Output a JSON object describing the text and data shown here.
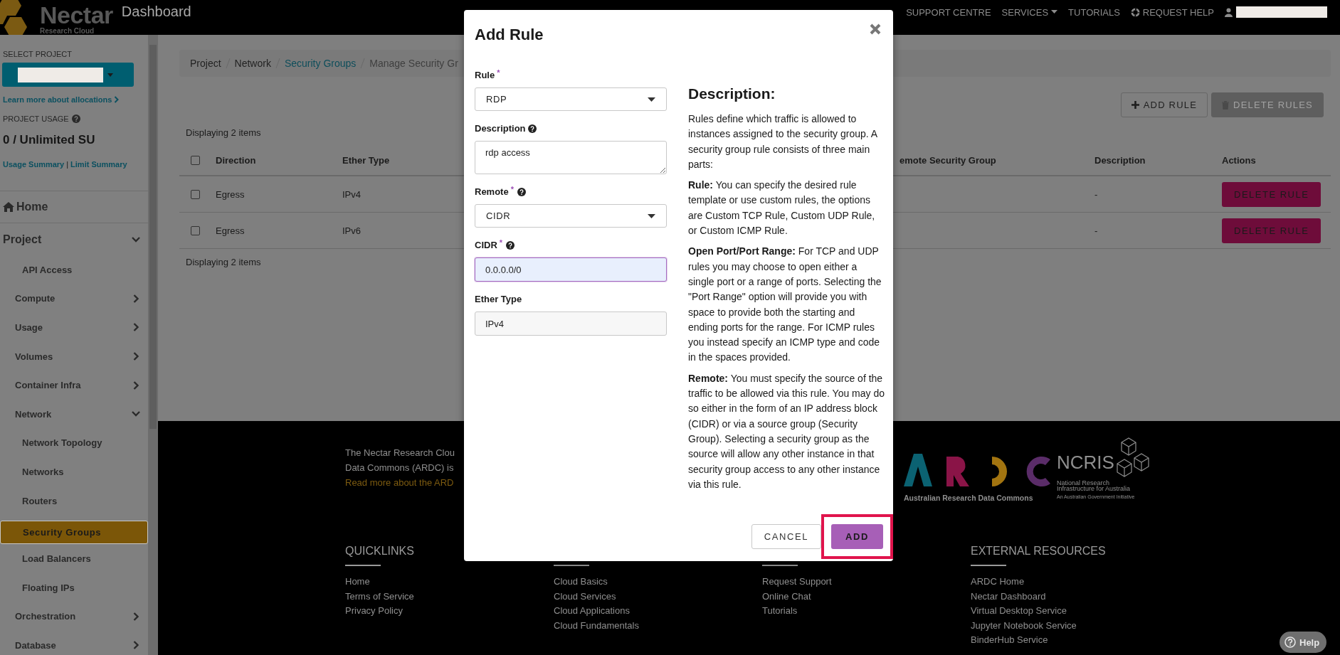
{
  "top_bar": {
    "brand": "Nectar",
    "brand_sub": "Research Cloud",
    "title": "Dashboard",
    "nav": [
      {
        "label": "SUPPORT CENTRE",
        "kind": "plain"
      },
      {
        "label": "SERVICES",
        "kind": "dropdown"
      },
      {
        "label": "TUTORIALS",
        "kind": "plain"
      },
      {
        "label": "REQUEST HELP",
        "kind": "help"
      }
    ]
  },
  "sidebar": {
    "select_project_label": "SELECT PROJECT",
    "allocations_link": "Learn more about allocations",
    "usage_label": "PROJECT USAGE",
    "usage_value": "0 / Unlimited SU",
    "usage_links": [
      "Usage Summary",
      "Limit Summary"
    ],
    "usage_separator": "|",
    "nav": [
      {
        "label": "Home",
        "kind": "home",
        "selected": false
      },
      {
        "label": "Project",
        "kind": "section",
        "selected": false,
        "expanded": true,
        "children": [
          {
            "label": "API Access",
            "selected": false
          },
          {
            "label": "Compute",
            "selected": false,
            "expanded": false
          },
          {
            "label": "Usage",
            "selected": false,
            "expanded": false
          },
          {
            "label": "Volumes",
            "selected": false,
            "expanded": false
          },
          {
            "label": "Container Infra",
            "selected": false,
            "expanded": false
          },
          {
            "label": "Network",
            "selected": false,
            "expanded": true,
            "children": [
              {
                "label": "Network Topology",
                "selected": false
              },
              {
                "label": "Networks",
                "selected": false
              },
              {
                "label": "Routers",
                "selected": false
              },
              {
                "label": "Security Groups",
                "selected": true
              },
              {
                "label": "Load Balancers",
                "selected": false
              },
              {
                "label": "Floating IPs",
                "selected": false
              }
            ]
          },
          {
            "label": "Orchestration",
            "selected": false,
            "expanded": false
          },
          {
            "label": "Database",
            "selected": false,
            "expanded": false
          }
        ]
      }
    ]
  },
  "main": {
    "breadcrumb": [
      {
        "label": "Project",
        "kind": "text"
      },
      {
        "label": "Network",
        "kind": "text"
      },
      {
        "label": "Security Groups",
        "kind": "link"
      },
      {
        "label": "Manage Security Gr",
        "kind": "current"
      }
    ],
    "actions": [
      {
        "label": "ADD RULE",
        "kind": "add",
        "disabled": false
      },
      {
        "label": "DELETE RULES",
        "kind": "delete",
        "disabled": true
      }
    ],
    "table": {
      "summary_top": "Displaying 2 items",
      "header_checked": false,
      "columns": [
        "Direction",
        "Ether Type",
        "emote Security Group",
        "Description",
        "Actions"
      ],
      "rows": [
        {
          "checked": false,
          "direction": "Egress",
          "ether_type": "IPv4",
          "description": "-",
          "action": "DELETE RULE"
        },
        {
          "checked": false,
          "direction": "Egress",
          "ether_type": "IPv6",
          "description": "-",
          "action": "DELETE RULE"
        }
      ],
      "summary_bottom": "Displaying 2 items"
    }
  },
  "footer": {
    "about": [
      "The Nectar Research Clou",
      "Data Commons (ARDC) is"
    ],
    "about_link": "Read more about the ARD",
    "ardc_caption": "Australian Research Data Commons",
    "ncris_title": "NCRIS",
    "ncris_lines": [
      "National Research",
      "Infrastructure for Australia"
    ],
    "ncris_tagline": "An Australian Government Initiative",
    "columns": [
      {
        "heading": "QUICKLINKS",
        "links": [
          "Home",
          "Terms of Service",
          "Privacy Policy"
        ]
      },
      {
        "links": [
          "Cloud Basics",
          "Cloud Services",
          "Cloud Applications",
          "Cloud Fundamentals"
        ]
      },
      {
        "links": [
          "Request Support",
          "Online Chat",
          "Tutorials"
        ]
      },
      {
        "heading": "EXTERNAL RESOURCES",
        "links": [
          "ARDC Home",
          "Nectar Dashboard",
          "Virtual Desktop Service",
          "Jupyter Notebook Service",
          "BinderHub Service"
        ]
      }
    ]
  },
  "help_button": "Help",
  "modal": {
    "title": "Add Rule",
    "fields": [
      {
        "label": "Rule",
        "required_mark": "*",
        "help": false,
        "kind": "select",
        "value": "RDP",
        "focused": false
      },
      {
        "label": "Description",
        "help": true,
        "kind": "textarea",
        "value": "rdp access",
        "focused": false
      },
      {
        "label": "Remote",
        "required_mark": "*",
        "help": true,
        "kind": "select",
        "value": "CIDR",
        "focused": false
      },
      {
        "label": "CIDR",
        "required_mark": "*",
        "help": true,
        "kind": "input",
        "value": "0.0.0.0/0",
        "focused": true
      },
      {
        "label": "Ether Type",
        "help": false,
        "kind": "readonly",
        "value": "IPv4",
        "focused": false
      }
    ],
    "description_heading": "Description:",
    "description": [
      "Rules define which traffic is allowed to instances assigned to the security group. A security group rule consists of three main parts:",
      "**Rule:** You can specify the desired rule template or use custom rules, the options are Custom TCP Rule, Custom UDP Rule, or Custom ICMP Rule.",
      "**Open Port/Port Range:** For TCP and UDP rules you may choose to open either a single port or a range of ports. Selecting the \"Port Range\" option will provide you with space to provide both the starting and ending ports for the range. For ICMP rules you instead specify an ICMP type and code in the spaces provided.",
      "**Remote:** You must specify the source of the traffic to be allowed via this rule. You may do so either in the form of an IP address block (CIDR) or via a source group (Security Group). Selecting a security group as the source will allow any other instance in that security group access to any other instance via this rule."
    ],
    "buttons": [
      {
        "label": "CANCEL",
        "kind": "secondary",
        "highlighted": false
      },
      {
        "label": "ADD",
        "kind": "primary",
        "highlighted": true
      }
    ]
  }
}
